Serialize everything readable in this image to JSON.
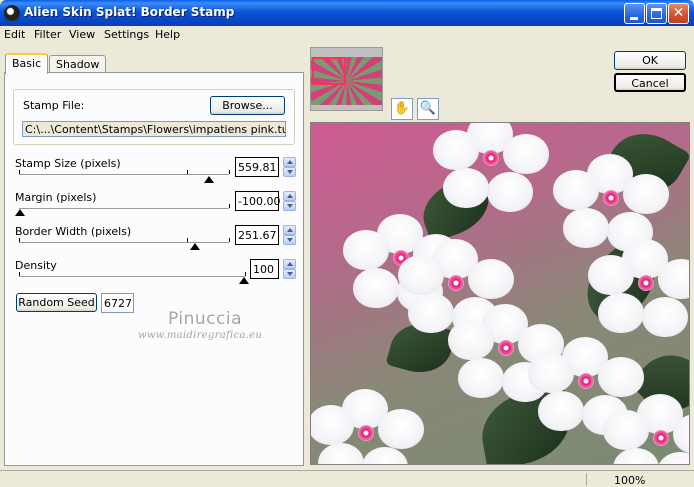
{
  "window": {
    "title": "Alien Skin Splat! Border Stamp"
  },
  "menu": [
    "Edit",
    "Filter",
    "View",
    "Settings",
    "Help"
  ],
  "tabs": {
    "basic": "Basic",
    "shadow": "Shadow"
  },
  "stamp": {
    "label": "Stamp File:",
    "browse": "Browse...",
    "path": "C:\\...\\Content\\Stamps\\Flowers\\impatiens pink.tub"
  },
  "params": {
    "stamp_size": {
      "label": "Stamp Size (pixels)",
      "value": "559.81"
    },
    "margin": {
      "label": "Margin (pixels)",
      "value": "-100.00"
    },
    "border_width": {
      "label": "Border Width (pixels)",
      "value": "251.67"
    },
    "density": {
      "label": "Density",
      "value": "100"
    }
  },
  "seed": {
    "button": "Random Seed",
    "value": "6727"
  },
  "watermark": {
    "name": "Pinuccia",
    "url": "www.maidiregrafica.eu"
  },
  "buttons": {
    "ok": "OK",
    "cancel": "Cancel"
  },
  "tools": {
    "hand": "✋",
    "zoom": "🔍"
  },
  "status": {
    "zoom": "100%"
  },
  "colors": {
    "titlebar": "#0a55d8",
    "accent": "#ffc83c",
    "preview_bg": "#cf5b91"
  }
}
